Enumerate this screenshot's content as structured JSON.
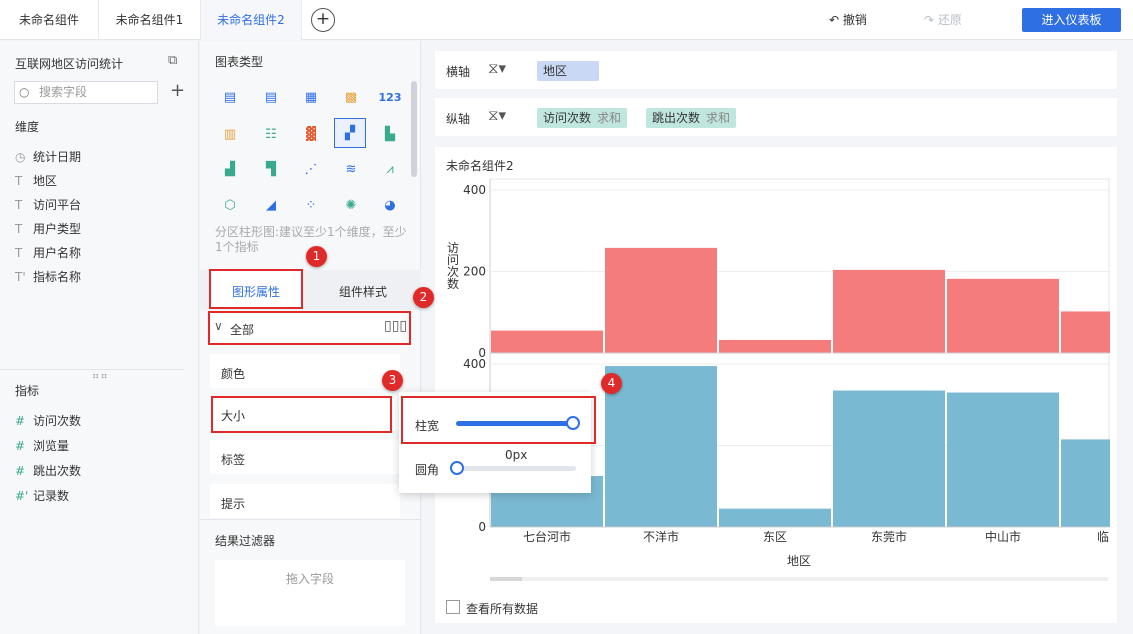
{
  "tabs": [
    "未命名组件",
    "未命名组件1",
    "未命名组件2"
  ],
  "active_tab": 2,
  "toolbar": {
    "undo": "撤销",
    "redo": "还原",
    "enter": "进入仪表板"
  },
  "sidebar": {
    "dataset_title": "互联网地区访问统计",
    "search_placeholder": "搜索字段",
    "dimension_label": "维度",
    "dimensions": [
      {
        "icon": "clock",
        "label": "统计日期"
      },
      {
        "icon": "T",
        "label": "地区"
      },
      {
        "icon": "T",
        "label": "访问平台"
      },
      {
        "icon": "T",
        "label": "用户类型"
      },
      {
        "icon": "T",
        "label": "用户名称"
      },
      {
        "icon": "T'",
        "label": "指标名称"
      }
    ],
    "measure_label": "指标",
    "measures": [
      {
        "icon": "#",
        "label": "访问次数"
      },
      {
        "icon": "#",
        "label": "浏览量"
      },
      {
        "icon": "#",
        "label": "跳出次数"
      },
      {
        "icon": "#'",
        "label": "记录数"
      }
    ]
  },
  "config": {
    "chart_type_title": "图表类型",
    "hint": "分区柱形图:建议至少1个维度，至少1个指标",
    "tab_graphic": "图形属性",
    "tab_component": "组件样式",
    "all_label": "全部",
    "props": [
      "颜色",
      "大小",
      "标签",
      "提示"
    ],
    "filter_title": "结果过滤器",
    "drop_hint": "拖入字段"
  },
  "popover": {
    "bar_width_label": "柱宽",
    "bar_width_value": 1.0,
    "corner_label": "圆角",
    "corner_value": "0px",
    "corner_fraction": 0.0
  },
  "axes": {
    "x_label": "横轴",
    "y_label": "纵轴",
    "x_fields": [
      {
        "name": "地区"
      }
    ],
    "y_fields": [
      {
        "name": "访问次数",
        "agg": "求和"
      },
      {
        "name": "跳出次数",
        "agg": "求和"
      }
    ]
  },
  "chart_card": {
    "title": "未命名组件2",
    "show_all": "查看所有数据"
  },
  "chart_data": {
    "type": "bar",
    "categories": [
      "七台河市",
      "不洋市",
      "东区",
      "东莞市",
      "中山市",
      "临"
    ],
    "xlabel": "地区",
    "panels": [
      {
        "name": "访问次数",
        "ylabel": "访问次数",
        "ylim": [
          0,
          400
        ],
        "ticks": [
          0,
          200,
          400
        ],
        "color": "#f47c7c",
        "values": [
          55,
          258,
          32,
          204,
          182,
          102
        ]
      },
      {
        "name": "跳出次数",
        "ylabel": "",
        "ylim": [
          0,
          400
        ],
        "ticks": [
          0,
          400
        ],
        "color": "#7ab9d2",
        "values": [
          125,
          395,
          45,
          335,
          330,
          215
        ]
      }
    ]
  },
  "annotations": [
    "1",
    "2",
    "3",
    "4"
  ],
  "colors": {
    "accent": "#2f6fe4",
    "annotation": "#e02a2a"
  }
}
